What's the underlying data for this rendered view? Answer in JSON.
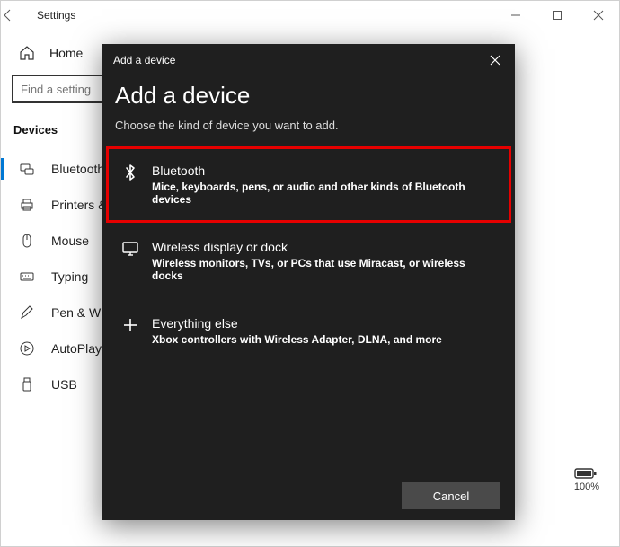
{
  "window": {
    "title": "Settings"
  },
  "sidebar": {
    "home_label": "Home",
    "search_placeholder": "Find a setting",
    "section": "Devices",
    "items": [
      {
        "label": "Bluetooth & other devices",
        "active": true
      },
      {
        "label": "Printers & scanners"
      },
      {
        "label": "Mouse"
      },
      {
        "label": "Typing"
      },
      {
        "label": "Pen & Windows Ink"
      },
      {
        "label": "AutoPlay"
      },
      {
        "label": "USB"
      }
    ]
  },
  "battery": {
    "label": "100%"
  },
  "modal": {
    "small_title": "Add a device",
    "title": "Add a device",
    "subtitle": "Choose the kind of device you want to add.",
    "options": [
      {
        "title": "Bluetooth",
        "desc": "Mice, keyboards, pens, or audio and other kinds of Bluetooth devices",
        "highlight": true
      },
      {
        "title": "Wireless display or dock",
        "desc": "Wireless monitors, TVs, or PCs that use Miracast, or wireless docks"
      },
      {
        "title": "Everything else",
        "desc": "Xbox controllers with Wireless Adapter, DLNA, and more"
      }
    ],
    "cancel_label": "Cancel"
  }
}
